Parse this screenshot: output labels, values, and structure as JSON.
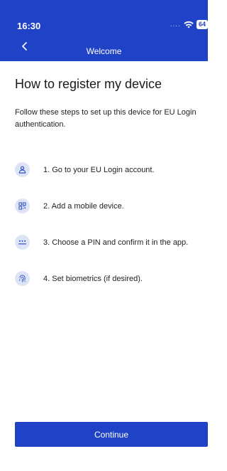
{
  "status_bar": {
    "time": "16:30",
    "signal_dots": "....",
    "battery": "64"
  },
  "nav": {
    "title": "Welcome",
    "back_icon": "chevron-left-icon"
  },
  "page": {
    "title": "How to register my device",
    "subtitle": "Follow these steps to set up this device for EU Login authentication."
  },
  "steps": [
    {
      "label": "1. Go to your EU Login account.",
      "icon": "user-icon"
    },
    {
      "label": "2. Add a mobile device.",
      "icon": "qr-scan-icon"
    },
    {
      "label": "3. Choose a PIN and confirm it in the app.",
      "icon": "pin-dots-icon"
    },
    {
      "label": "4. Set biometrics (if desired).",
      "icon": "fingerprint-icon"
    }
  ],
  "continue_label": "Continue",
  "colors": {
    "primary": "#1f42c7",
    "icon_bg": "#dde4f6"
  }
}
